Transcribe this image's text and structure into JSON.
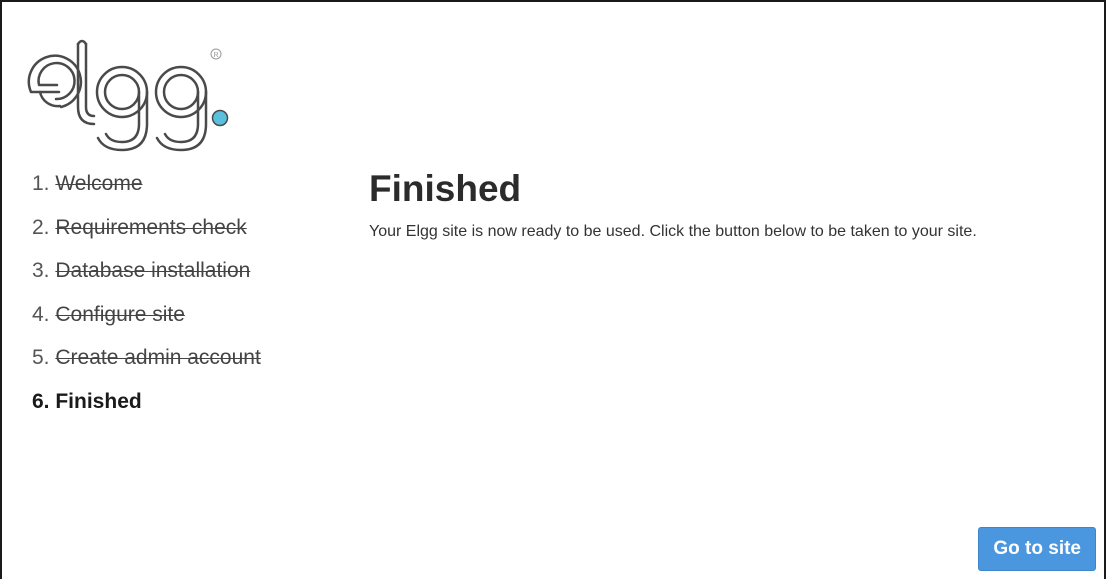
{
  "logo": {
    "text": "elgg.",
    "registered_mark": "®",
    "accent_color": "#5bc0de"
  },
  "steps": [
    {
      "number": "1.",
      "label": "Welcome",
      "state": "completed"
    },
    {
      "number": "2.",
      "label": "Requirements check",
      "state": "completed"
    },
    {
      "number": "3.",
      "label": "Database installation",
      "state": "completed"
    },
    {
      "number": "4.",
      "label": "Configure site",
      "state": "completed"
    },
    {
      "number": "5.",
      "label": "Create admin account",
      "state": "completed"
    },
    {
      "number": "6.",
      "label": "Finished",
      "state": "current"
    }
  ],
  "main": {
    "title": "Finished",
    "description": "Your Elgg site is now ready to be used. Click the button below to be taken to your site."
  },
  "actions": {
    "go_to_site_label": "Go to site"
  },
  "colors": {
    "button_bg": "#4b97df",
    "button_text": "#ffffff",
    "logo_outline": "#4a4a4a"
  }
}
